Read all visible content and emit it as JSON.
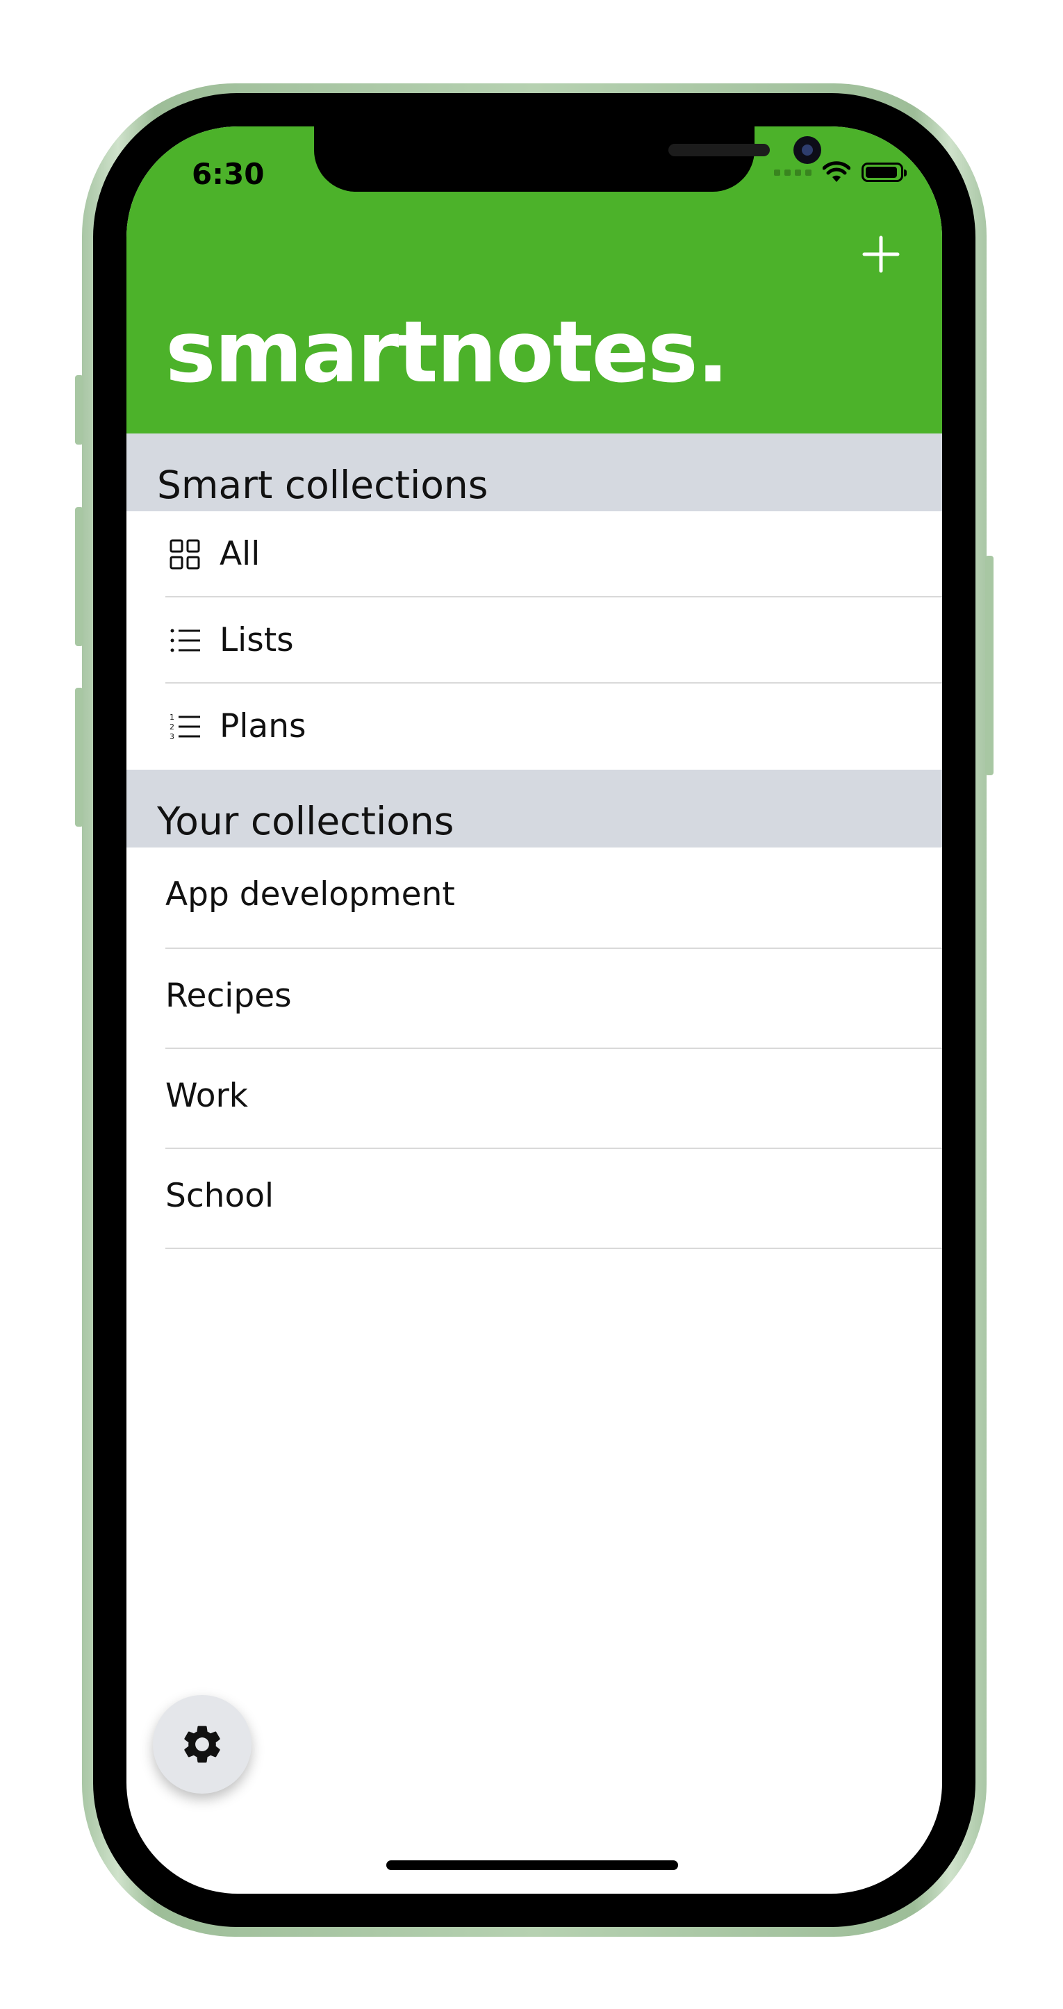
{
  "theme": {
    "accent": "#4cb22a",
    "section": "#d5d9e0"
  },
  "status_bar": {
    "time": "6:30",
    "icons": [
      "cellular-icon",
      "wifi-icon",
      "battery-icon"
    ]
  },
  "header": {
    "add_icon": "plus-icon",
    "brand": "smartnotes."
  },
  "smart_collections": {
    "title": "Smart collections",
    "items": [
      {
        "label": "All",
        "icon": "grid-icon"
      },
      {
        "label": "Lists",
        "icon": "list-icon"
      },
      {
        "label": "Plans",
        "icon": "numbered-list-icon"
      }
    ]
  },
  "your_collections": {
    "title": "Your collections",
    "items": [
      {
        "label": "App development"
      },
      {
        "label": "Recipes"
      },
      {
        "label": "Work"
      },
      {
        "label": "School"
      }
    ]
  },
  "settings": {
    "icon": "gear-icon"
  }
}
